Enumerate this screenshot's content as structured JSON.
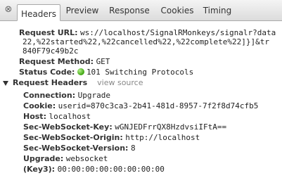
{
  "tabs": [
    {
      "label": "Headers"
    },
    {
      "label": "Preview"
    },
    {
      "label": "Response"
    },
    {
      "label": "Cookies"
    },
    {
      "label": "Timing"
    }
  ],
  "active_tab": "Headers",
  "close_glyph": "⊗",
  "general": {
    "request_url_label": "Request URL:",
    "request_url_line1": "ws://localhost/SignalRMonkeys/signalr?data",
    "request_url_line2": "22,%22started%22,%22cancelled%22,%22complete%22]}]&tr",
    "request_url_line3": "840F79c49b2c",
    "method_label": "Request Method:",
    "method_value": "GET",
    "status_label": "Status Code:",
    "status_value": "101 Switching Protocols",
    "status_color": "#3ca30f"
  },
  "request_headers": {
    "title": "Request Headers",
    "view_source": "view source",
    "items": [
      {
        "name": "Connection:",
        "value": "Upgrade"
      },
      {
        "name": "Cookie:",
        "value": "userid=870c3ca3-2b41-481d-8957-7f2f8d74cfb5"
      },
      {
        "name": "Host:",
        "value": "localhost"
      },
      {
        "name": "Sec-WebSocket-Key:",
        "value": "wGNJEDFrrQX8HzdvsiIFtA=="
      },
      {
        "name": "Sec-WebSocket-Origin:",
        "value": "http://localhost"
      },
      {
        "name": "Sec-WebSocket-Version:",
        "value": "8"
      },
      {
        "name": "Upgrade:",
        "value": "websocket"
      },
      {
        "name": "(Key3):",
        "value": "00:00:00:00:00:00:00:00"
      }
    ]
  }
}
